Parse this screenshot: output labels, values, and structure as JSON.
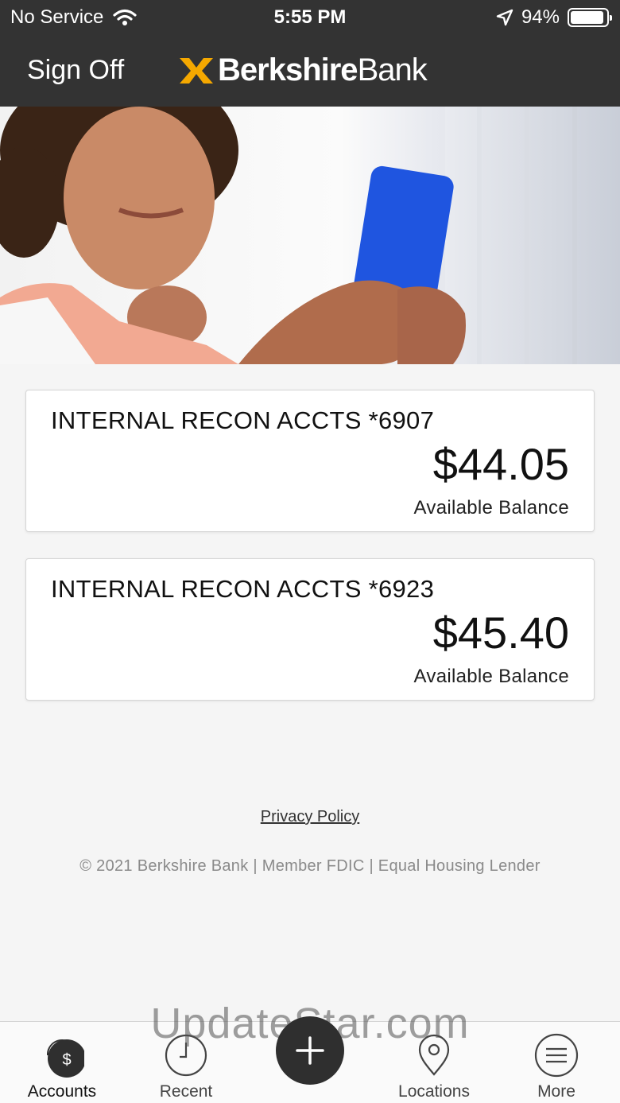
{
  "status_bar": {
    "carrier": "No Service",
    "time": "5:55 PM",
    "battery": "94%",
    "battery_level": 0.94
  },
  "header": {
    "sign_off_label": "Sign Off",
    "logo_text_bold": "Berkshire",
    "logo_text_regular": "Bank",
    "brand_color": "#F5A800"
  },
  "accounts": [
    {
      "name": "INTERNAL RECON ACCTS *6907",
      "balance": "$44.05",
      "balance_label": "Available Balance"
    },
    {
      "name": "INTERNAL RECON ACCTS *6923",
      "balance": "$45.40",
      "balance_label": "Available Balance"
    }
  ],
  "footer": {
    "privacy_link": "Privacy Policy",
    "copyright": "© 2021 Berkshire Bank | Member FDIC | Equal Housing Lender"
  },
  "watermark": "UpdateStar.com",
  "tab_bar": {
    "accounts_icon_glyph": "$",
    "add_icon": "plus-icon",
    "tabs": [
      {
        "label": "Accounts",
        "icon": "dollar-circle-icon",
        "active": true
      },
      {
        "label": "Recent",
        "icon": "clock-icon",
        "active": false
      },
      {
        "label": "Locations",
        "icon": "map-pin-icon",
        "active": false
      },
      {
        "label": "More",
        "icon": "menu-lines-icon",
        "active": false
      }
    ]
  }
}
